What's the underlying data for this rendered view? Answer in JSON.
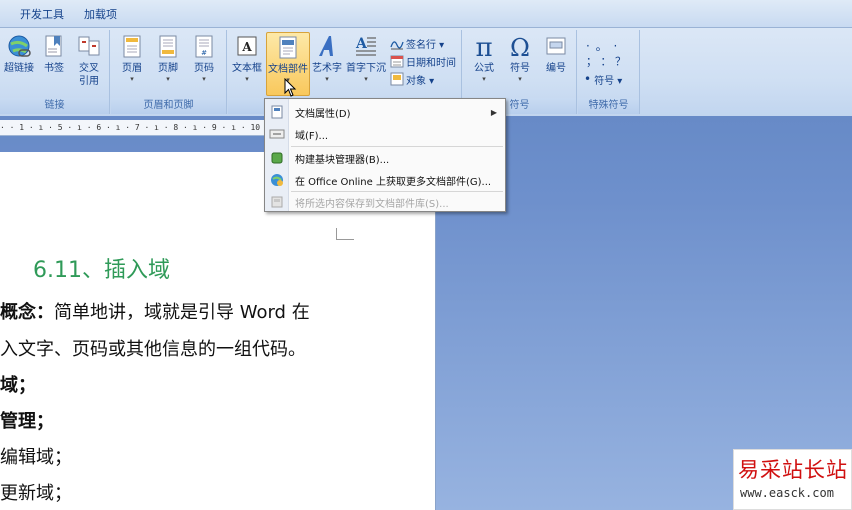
{
  "tabs": [
    "开发工具",
    "加载项"
  ],
  "ribbon": {
    "links_group": {
      "label": "链接",
      "buttons": [
        {
          "icon": "globe-link-icon",
          "label": "超链接"
        },
        {
          "icon": "bookmark-icon",
          "label": "书签"
        },
        {
          "icon": "cross-reference-icon",
          "label": "交叉\n引用"
        }
      ]
    },
    "header_footer_group": {
      "label": "页眉和页脚",
      "buttons": [
        {
          "icon": "header-icon",
          "label": "页眉"
        },
        {
          "icon": "footer-icon",
          "label": "页脚"
        },
        {
          "icon": "page-number-icon",
          "label": "页码"
        }
      ]
    },
    "text_group": {
      "buttons": [
        {
          "icon": "text-box-icon",
          "label": "文本框"
        },
        {
          "icon": "quick-parts-icon",
          "label": "文档部件",
          "active": true
        },
        {
          "icon": "wordart-icon",
          "label": "艺术字"
        },
        {
          "icon": "drop-cap-icon",
          "label": "首字下沉"
        }
      ],
      "small_items": [
        {
          "icon": "signature-line-icon",
          "label": "签名行 ▾"
        },
        {
          "icon": "date-time-icon",
          "label": "日期和时间"
        },
        {
          "icon": "object-icon",
          "label": "对象 ▾"
        }
      ]
    },
    "symbols_group": {
      "label": "符号",
      "buttons": [
        {
          "icon": "equation-pi-icon",
          "label": "公式"
        },
        {
          "icon": "symbol-omega-icon",
          "label": "符号"
        },
        {
          "icon": "numbering-icon",
          "label": "编号"
        }
      ]
    },
    "special_symbols_group": {
      "label": "特殊符号",
      "rows": [
        "·  。  ·",
        "；  ：  ？"
      ],
      "button": "符号 ▾"
    }
  },
  "ruler_text": "· · 1 · ı · 5 · ı · 6 · ı · 7 · ı · 8 · ı · 9 · ı · 10 · ı · 11 · ı · 12 · ı · 13",
  "menu": {
    "items": [
      {
        "icon": "document-property-icon",
        "label": "文档属性(D)",
        "submenu": true,
        "disabled": false
      },
      {
        "icon": "field-icon",
        "label": "域(F)...",
        "submenu": false,
        "disabled": false
      },
      {
        "icon": "building-blocks-icon",
        "label": "构建基块管理器(B)...",
        "submenu": false,
        "disabled": false
      },
      {
        "icon": "office-online-icon",
        "label": "在 Office Online 上获取更多文档部件(G)...",
        "submenu": false,
        "disabled": false
      },
      {
        "icon": "save-selection-icon",
        "label": "将所选内容保存到文档部件库(S)...",
        "submenu": false,
        "disabled": true
      }
    ]
  },
  "document": {
    "heading": "6.11、插入域",
    "lines": [
      {
        "bold": "概念：",
        "text": "简单地讲，域就是引导 Word 在"
      },
      {
        "bold": "",
        "text": "入文字、页码或其他信息的一组代码。"
      },
      {
        "bold": "域；",
        "text": ""
      },
      {
        "bold": "管理；",
        "text": ""
      },
      {
        "bold": "",
        "text": "编辑域；"
      },
      {
        "bold": "",
        "text": "更新域；"
      }
    ]
  },
  "watermark": {
    "title": "易采站长站",
    "url": "www.easck.com"
  },
  "colors": {
    "heading": "#2f9a58",
    "ribbon": "#cfdff3",
    "background": "#6e90cc",
    "watermark_title": "#d01010"
  }
}
